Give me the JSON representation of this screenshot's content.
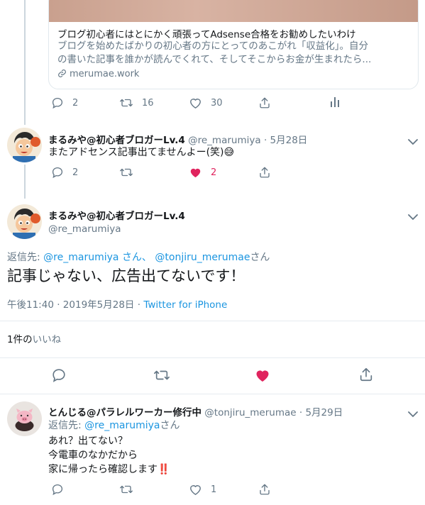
{
  "card": {
    "title": "ブログ初心者にはとにかく頑張ってAdsense合格をお勧めしたいわけ",
    "desc_line1": "ブログを始めたばかりの初心者の方にとってのあこがれ「収益化」。自分",
    "desc_line2": "の書いた記事を誰かが読んでくれて、そしてそこからお金が生まれたら...",
    "domain": "merumae.work"
  },
  "tweet1_actions": {
    "reply": "2",
    "retweet": "16",
    "like": "30"
  },
  "tweet2": {
    "name": "まるみや@初心者ブロガーLv.4",
    "handle": "@re_marumiya",
    "sep": "·",
    "date": "5月28日",
    "text": "またアドセンス記事出てませんよー(笑)",
    "emoji": "😅",
    "reply_count": "2",
    "like_count": "2"
  },
  "main": {
    "name": "まるみや@初心者ブロガーLv.4",
    "handle": "@re_marumiya",
    "reply_to_label": "返信先:",
    "reply_to_user1": "@re_marumiya",
    "reply_to_san1": "さん、",
    "reply_to_user2": "@tonjiru_merumae",
    "reply_to_san2": "さん",
    "text": "記事じゃない、広告出てないです！",
    "time": "午後11:40",
    "sep": "·",
    "date": "2019年5月28日",
    "via": "Twitter for iPhone",
    "likes_count": "1件の",
    "likes_label": "いいね"
  },
  "tweet4": {
    "name": "とんじる@パラレルワーカー修行中",
    "handle": "@tonjiru_merumae",
    "sep": "·",
    "date": "5月29日",
    "reply_to_label": "返信先:",
    "reply_to_user": "@re_marumiya",
    "reply_to_san": "さん",
    "line1": "あれ？出てない？",
    "line2": "今電車のなかだから",
    "line3": "家に帰ったら確認します",
    "emoji": "‼️",
    "like_count": "1"
  },
  "colors": {
    "link": "#1b95e0",
    "muted": "#657786",
    "like": "#e0245e",
    "divider": "#e6ecf0"
  }
}
